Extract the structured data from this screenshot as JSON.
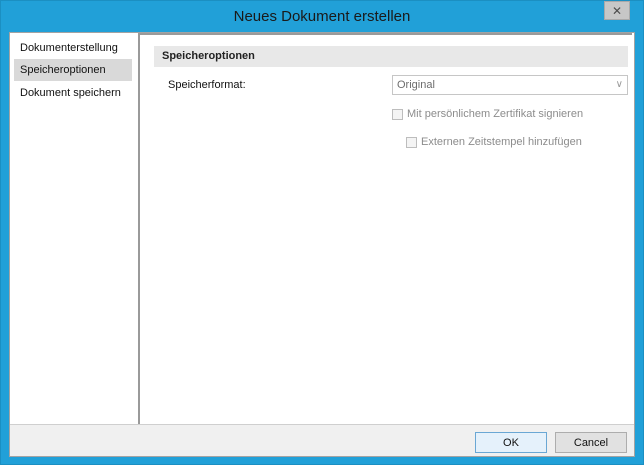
{
  "window": {
    "title": "Neues Dokument erstellen",
    "close_icon": "close-icon"
  },
  "nav": {
    "items": [
      {
        "label": "Dokumenterstellung",
        "selected": false
      },
      {
        "label": "Speicheroptionen",
        "selected": true
      },
      {
        "label": "Dokument speichern",
        "selected": false
      }
    ]
  },
  "section": {
    "header": "Speicheroptionen",
    "format_label": "Speicherformat:",
    "format_value": "Original",
    "sign_label": "Mit persönlichem Zertifikat signieren",
    "timestamp_label": "Externen Zeitstempel hinzufügen"
  },
  "buttons": {
    "ok": "OK",
    "cancel": "Cancel"
  },
  "colors": {
    "title_bar": "#21a0d8",
    "selected_item": "#d9d9d9",
    "section_header": "#e8e8e8"
  }
}
